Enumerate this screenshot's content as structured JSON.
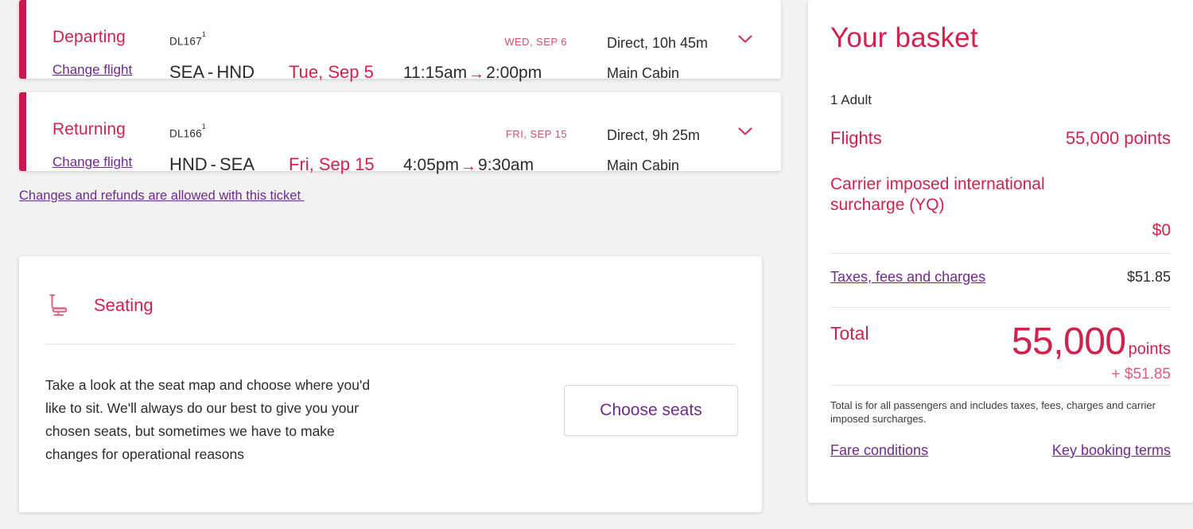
{
  "theme": {
    "brand_red": "#d0224d",
    "accent_bar": "#c8184d",
    "link_purple": "#6f2b8c",
    "page_bg": "#f2f2f2",
    "card_bg": "#ffffff"
  },
  "flights": [
    {
      "leg_label": "Departing",
      "change_flight_label": "Change flight",
      "flight_number": "DL167",
      "flight_number_superscript": "1",
      "origin": "SEA",
      "separator": "-",
      "destination": "HND",
      "depart_date": "Tue, Sep 5",
      "arrive_day_note": "WED, SEP 6",
      "depart_time": "11:15am",
      "arrow": "→",
      "arrive_time": "2:00pm",
      "stops_and_duration": "Direct, 10h 45m",
      "cabin": "Main Cabin",
      "expand_icon": "chevron-down-icon"
    },
    {
      "leg_label": "Returning",
      "change_flight_label": "Change flight",
      "flight_number": "DL166",
      "flight_number_superscript": "1",
      "origin": "HND",
      "separator": "-",
      "destination": "SEA",
      "depart_date": "Fri, Sep 15",
      "arrive_day_note": "FRI, SEP 15",
      "depart_time": "4:05pm",
      "arrow": "→",
      "arrive_time": "9:30am",
      "stops_and_duration": "Direct, 9h 25m",
      "cabin": "Main Cabin",
      "expand_icon": "chevron-down-icon"
    }
  ],
  "refund_link": "Changes and refunds are allowed with this ticket ",
  "seating": {
    "icon": "airplane-seat-icon",
    "title": "Seating",
    "description": "Take a look at the seat map and choose where you'd like to sit. We'll always do our best to give you your chosen seats, but sometimes we have to make changes for operational reasons",
    "button_label": "Choose seats"
  },
  "basket": {
    "title": "Your basket",
    "passengers": "1 Adult",
    "flights_label": "Flights",
    "flights_value": "55,000 points",
    "surcharge_label": "Carrier imposed international surcharge (YQ)",
    "surcharge_value": "$0",
    "taxes_label": "Taxes, fees and charges",
    "taxes_value": "$51.85",
    "total_label": "Total",
    "total_points": "55,000",
    "total_points_unit": "points",
    "total_cash": "+ $51.85",
    "fine_print": "Total is for all passengers and includes taxes, fees, charges and carrier imposed surcharges.",
    "fare_conditions_link": "Fare conditions",
    "key_booking_terms_link": "Key booking terms"
  }
}
